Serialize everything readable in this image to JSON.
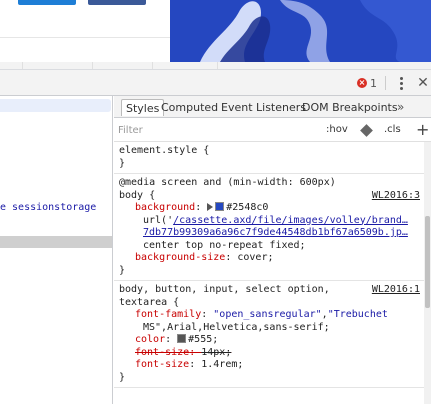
{
  "devtools": {
    "error_count": "1",
    "tabs": [
      {
        "label": "Styles",
        "active": true
      },
      {
        "label": "Computed",
        "active": false
      },
      {
        "label": "Event Listeners",
        "active": false
      },
      {
        "label": "DOM Breakpoints",
        "active": false
      }
    ],
    "more_tabs": "»",
    "filter_placeholder": "Filter",
    "hov_label": ":hov",
    "cls_label": ".cls",
    "add_label": "+",
    "left_panel_text": "e sessionstorage"
  },
  "colors": {
    "background_swatch": "#2548c0",
    "color_swatch": "#555555",
    "accent": "#1e7ed6"
  },
  "rules": {
    "element_style": {
      "selector": "element.style {",
      "close": "}"
    },
    "body_bg": {
      "media": "@media screen and (min-width: 600px)",
      "selector": "body {",
      "source": "WL2016:3",
      "bg_prop": "background",
      "bg_value": "#2548c0",
      "url_prefix": "url('",
      "url_line1": "/cassette.axd/file/images/volley/brand…",
      "url_line2": "7db77b99309a6a96c7f9de44548db1bf67a6509b.jp…",
      "bg_tail": "center top no-repeat fixed;",
      "size_prop": "background-size",
      "size_value": "cover;",
      "close": "}"
    },
    "body_font": {
      "selector_line1": "body, button, input, select option,",
      "selector_line2": "textarea {",
      "source": "WL2016:1",
      "ff_prop": "font-family",
      "ff_value1": "\"open_sansregular\"",
      "ff_value2": "\"Trebuchet",
      "ff_value3": "MS\",Arial,Helvetica,sans-serif;",
      "color_prop": "color",
      "color_value": "#555;",
      "fs_old_prop": "font-size",
      "fs_old_value": "14px;",
      "fs_prop": "font-size",
      "fs_value": "1.4rem;",
      "close": "}"
    }
  }
}
